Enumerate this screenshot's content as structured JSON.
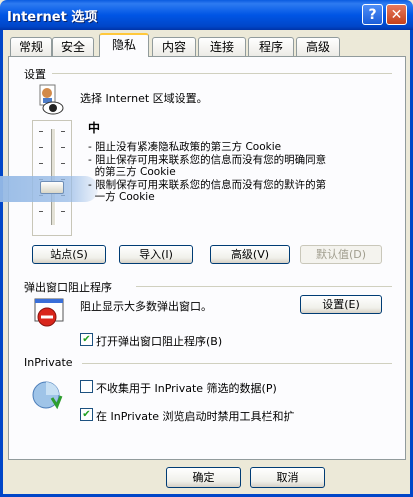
{
  "window": {
    "title": "Internet 选项",
    "help_symbol": "?",
    "close_symbol": "✕"
  },
  "tabs": [
    {
      "label": "常规"
    },
    {
      "label": "安全"
    },
    {
      "label": "隐私"
    },
    {
      "label": "内容"
    },
    {
      "label": "连接"
    },
    {
      "label": "程序"
    },
    {
      "label": "高级"
    }
  ],
  "active_tab": "隐私",
  "settings": {
    "group_label": "设置",
    "heading": "选择 Internet 区域设置。",
    "level": "中",
    "level_position": "medium",
    "bullets": [
      "- 阻止没有紧凑隐私政策的第三方 Cookie",
      "- 阻止保存可用来联系您的信息而没有您的明确同意",
      "  的第三方 Cookie",
      "- 限制保存可用来联系您的信息而没有您的默许的第",
      "  一方 Cookie"
    ],
    "buttons": {
      "sites": "站点(S)",
      "import": "导入(I)",
      "advanced": "高级(V)",
      "default": "默认值(D)"
    }
  },
  "popup": {
    "group_label": "弹出窗口阻止程序",
    "description": "阻止显示大多数弹出窗口。",
    "settings_button": "设置(E)",
    "enable_label": "打开弹出窗口阻止程序(B)",
    "enable_checked": true
  },
  "inprivate": {
    "group_label": "InPrivate",
    "collect_label": "不收集用于 InPrivate 筛选的数据(P)",
    "collect_checked": false,
    "disable_label": "在 InPrivate 浏览启动时禁用工具栏和扩",
    "disable_checked": true
  },
  "footer": {
    "ok": "确定",
    "cancel": "取消"
  },
  "colors": {
    "title_bar": "#0055E5",
    "dialog_bg": "#ECE9D8",
    "active_tab_accent": "#FFC83C"
  }
}
